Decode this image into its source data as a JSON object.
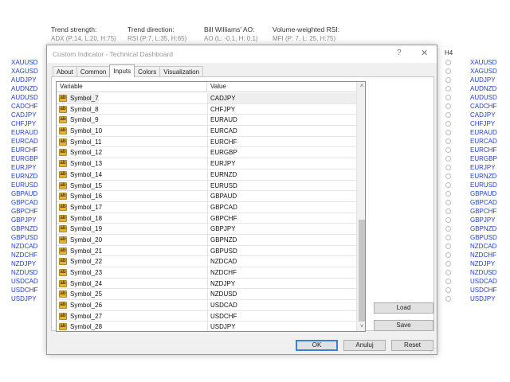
{
  "background": {
    "headers": [
      {
        "title": "Trend strength:",
        "detail": "ADX (P:14, L:20, H:75)"
      },
      {
        "title": "Trend direction:",
        "detail": "RSI (P:7, L:35, H:65)"
      },
      {
        "title": "Bill Williams' AO:",
        "detail": "AO (L: -0.1, H: 0.1)"
      },
      {
        "title": "Volume-weighted RSI:",
        "detail": "MFI (P: 7, L: 25, H:75)"
      }
    ],
    "left_symbols": [
      "XAUUSD",
      "XAGUSD",
      "AUDJPY",
      "AUDNZD",
      "AUDUSD",
      "CADCHF",
      "CADJPY",
      "CHFJPY",
      "EURAUD",
      "EURCAD",
      "EURCHF",
      "EURGBP",
      "EURJPY",
      "EURNZD",
      "EURUSD",
      "GBPAUD",
      "GBPCAD",
      "GBPCHF",
      "GBPJPY",
      "GBPNZD",
      "GBPUSD",
      "NZDCAD",
      "NZDCHF",
      "NZDJPY",
      "NZDUSD",
      "USDCAD",
      "USDCHF",
      "USDJPY"
    ],
    "timeframe": "H4",
    "right_symbols": [
      "XAUUSD",
      "XAGUSD",
      "AUDJPY",
      "AUDNZD",
      "AUDUSD",
      "CADCHF",
      "CADJPY",
      "CHFJPY",
      "EURAUD",
      "EURCAD",
      "EURCHF",
      "EURGBP",
      "EURJPY",
      "EURNZD",
      "EURUSD",
      "GBPAUD",
      "GBPCAD",
      "GBPCHF",
      "GBPJPY",
      "GBPNZD",
      "GBPUSD",
      "NZDCAD",
      "NZDCHF",
      "NZDJPY",
      "NZDUSD",
      "USDCAD",
      "USDCHF",
      "USDJPY"
    ],
    "link_color": "#1f3fd6"
  },
  "dialog": {
    "title": "Custom Indicator - Technical Dashboard",
    "help_label": "?",
    "close_label": "✕",
    "tabs": [
      "About",
      "Common",
      "Inputs",
      "Colors",
      "Visualization"
    ],
    "active_tab": "Inputs",
    "grid": {
      "col_variable": "Variable",
      "col_value": "Value",
      "rows": [
        {
          "variable": "Symbol_7",
          "value": "CADJPY"
        },
        {
          "variable": "Symbol_8",
          "value": "CHFJPY"
        },
        {
          "variable": "Symbol_9",
          "value": "EURAUD"
        },
        {
          "variable": "Symbol_10",
          "value": "EURCAD"
        },
        {
          "variable": "Symbol_11",
          "value": "EURCHF"
        },
        {
          "variable": "Symbol_12",
          "value": "EURGBP"
        },
        {
          "variable": "Symbol_13",
          "value": "EURJPY"
        },
        {
          "variable": "Symbol_14",
          "value": "EURNZD"
        },
        {
          "variable": "Symbol_15",
          "value": "EURUSD"
        },
        {
          "variable": "Symbol_16",
          "value": "GBPAUD"
        },
        {
          "variable": "Symbol_17",
          "value": "GBPCAD"
        },
        {
          "variable": "Symbol_18",
          "value": "GBPCHF"
        },
        {
          "variable": "Symbol_19",
          "value": "GBPJPY"
        },
        {
          "variable": "Symbol_20",
          "value": "GBPNZD"
        },
        {
          "variable": "Symbol_21",
          "value": "GBPUSD"
        },
        {
          "variable": "Symbol_22",
          "value": "NZDCAD"
        },
        {
          "variable": "Symbol_23",
          "value": "NZDCHF"
        },
        {
          "variable": "Symbol_24",
          "value": "NZDJPY"
        },
        {
          "variable": "Symbol_25",
          "value": "NZDUSD"
        },
        {
          "variable": "Symbol_26",
          "value": "USDCAD"
        },
        {
          "variable": "Symbol_27",
          "value": "USDCHF"
        },
        {
          "variable": "Symbol_28",
          "value": "USDJPY"
        }
      ],
      "type_icon_text": "ab"
    },
    "buttons": {
      "load": "Load",
      "save": "Save",
      "ok": "OK",
      "cancel": "Anuluj",
      "reset": "Reset"
    }
  }
}
